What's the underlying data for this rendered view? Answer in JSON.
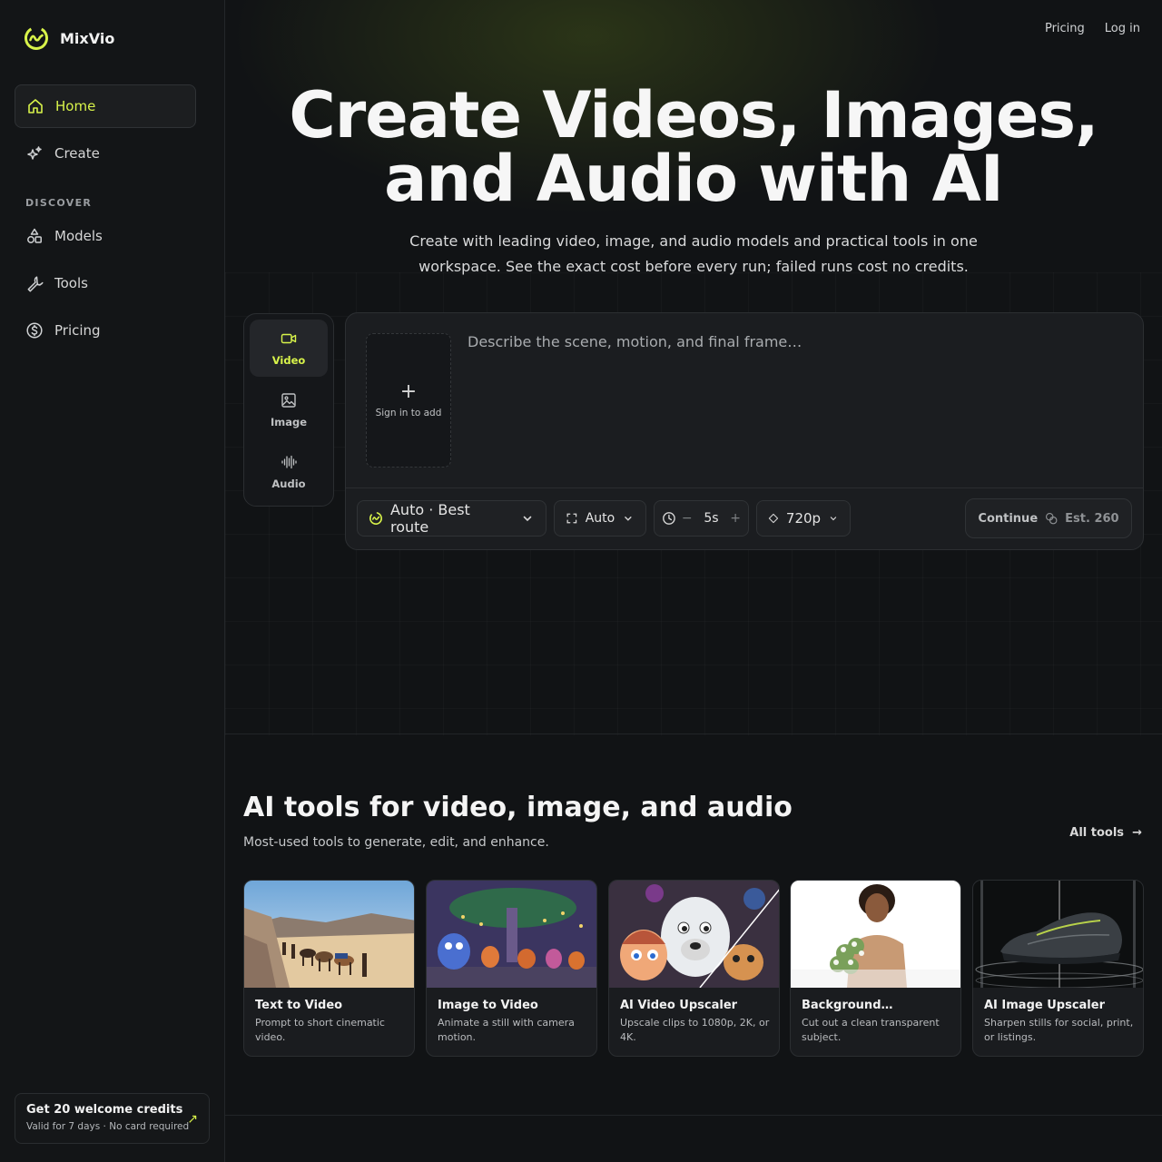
{
  "brand": {
    "name": "MixVio",
    "accent": "#d8f34a"
  },
  "sidebar": {
    "items": [
      {
        "label": "Home",
        "icon": "home-icon",
        "active": true
      },
      {
        "label": "Create",
        "icon": "sparkles-icon"
      },
      {
        "label": "Models",
        "icon": "shapes-icon"
      },
      {
        "label": "Tools",
        "icon": "wrench-icon"
      },
      {
        "label": "Pricing",
        "icon": "dollar-circle-icon"
      }
    ],
    "section_discover": "DISCOVER",
    "promo": {
      "title": "Get 20 welcome credits",
      "subtitle": "Valid for 7 days · No card required"
    }
  },
  "topnav": {
    "pricing": "Pricing",
    "login": "Log in"
  },
  "hero": {
    "title_line1": "Create Videos, Images,",
    "title_line2": "and Audio with AI",
    "subtitle": "Create with leading video, image, and audio models and practical tools in one workspace. See the exact cost before every run; failed runs cost no credits."
  },
  "modes": [
    {
      "label": "Video",
      "icon": "video-camera-icon",
      "active": true
    },
    {
      "label": "Image",
      "icon": "image-icon"
    },
    {
      "label": "Audio",
      "icon": "waveform-icon"
    }
  ],
  "composer": {
    "upload_label": "Sign in to add",
    "prompt_placeholder": "Describe the scene, motion, and final frame…",
    "model_select": "Auto · Best route",
    "aspect_select": "Auto",
    "duration": "5s",
    "resolution": "720p",
    "continue_label": "Continue",
    "estimate": "Est. 260"
  },
  "tools_section": {
    "title": "AI tools for video, image, and audio",
    "subtitle": "Most-used tools to generate, edit, and enhance.",
    "all_tools": "All tools",
    "cards": [
      {
        "title": "Text to Video",
        "desc": "Prompt to short cinematic video."
      },
      {
        "title": "Image to Video",
        "desc": "Animate a still with camera motion."
      },
      {
        "title": "AI Video Upscaler",
        "desc": "Upscale clips to 1080p, 2K, or 4K."
      },
      {
        "title": "Background…",
        "desc": "Cut out a clean transparent subject."
      },
      {
        "title": "AI Image Upscaler",
        "desc": "Sharpen stills for social, print, or listings."
      }
    ]
  }
}
